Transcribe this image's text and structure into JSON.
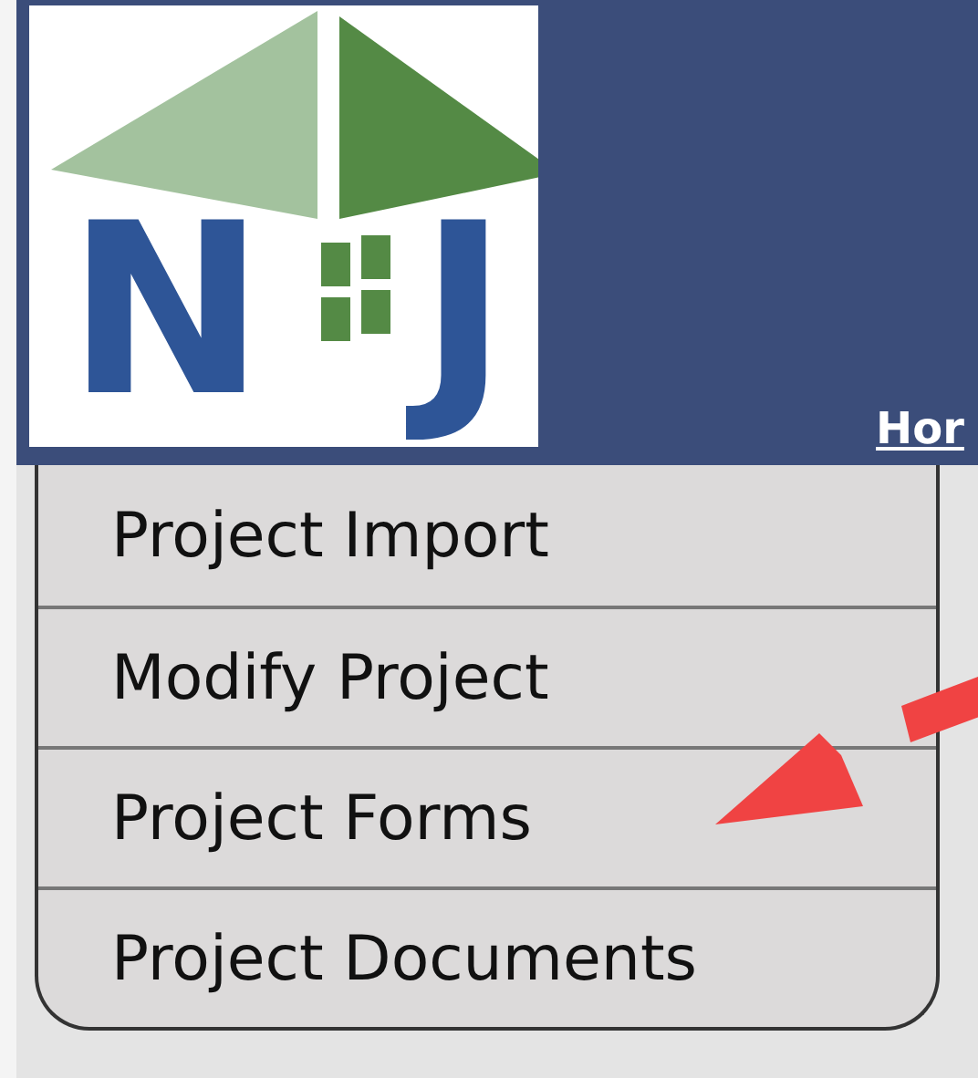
{
  "header": {
    "logo": {
      "letters": [
        "N",
        "J"
      ]
    },
    "nav_link": "Hor"
  },
  "menu": {
    "items": [
      {
        "label": "Project Import"
      },
      {
        "label": "Modify Project"
      },
      {
        "label": "Project Forms"
      },
      {
        "label": "Project Documents"
      }
    ]
  }
}
